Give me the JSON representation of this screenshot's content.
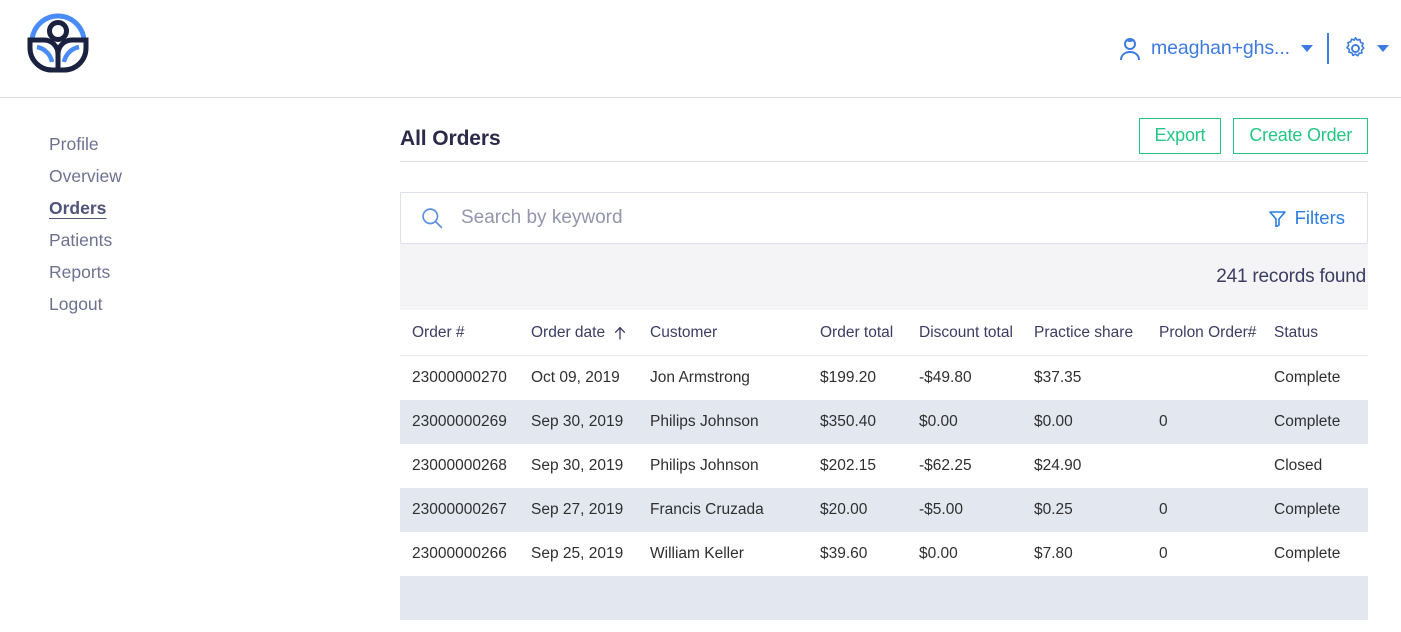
{
  "header": {
    "logo_name": "company-logo",
    "user": {
      "name": "meaghan+ghs...",
      "icon": "user-icon"
    },
    "settings": {
      "icon": "gear-icon"
    }
  },
  "sidebar": {
    "items": [
      {
        "label": "Profile",
        "active": false
      },
      {
        "label": "Overview",
        "active": false
      },
      {
        "label": "Orders",
        "active": true
      },
      {
        "label": "Patients",
        "active": false
      },
      {
        "label": "Reports",
        "active": false
      },
      {
        "label": "Logout",
        "active": false
      }
    ]
  },
  "main": {
    "title": "All Orders",
    "actions": {
      "export_label": "Export",
      "create_order_label": "Create Order"
    },
    "search": {
      "placeholder": "Search by keyword",
      "value": "",
      "icon": "search-icon"
    },
    "filters": {
      "label": "Filters",
      "icon": "filter-icon"
    },
    "records_found": "241 records found",
    "table": {
      "columns": [
        {
          "label": "Order #",
          "sort": null
        },
        {
          "label": "Order date",
          "sort": "asc"
        },
        {
          "label": "Customer",
          "sort": null
        },
        {
          "label": "Order total",
          "sort": null
        },
        {
          "label": "Discount total",
          "sort": null
        },
        {
          "label": "Practice share",
          "sort": null
        },
        {
          "label": "Prolon Order#",
          "sort": null
        },
        {
          "label": "Status",
          "sort": null
        }
      ],
      "rows": [
        {
          "order_number": "23000000270",
          "order_date": "Oct 09, 2019",
          "customer": "Jon Armstrong",
          "order_total": "$199.20",
          "discount_total": "-$49.80",
          "practice_share": "$37.35",
          "prolon_order": "",
          "status": "Complete"
        },
        {
          "order_number": "23000000269",
          "order_date": "Sep 30, 2019",
          "customer": "Philips Johnson",
          "order_total": "$350.40",
          "discount_total": "$0.00",
          "practice_share": "$0.00",
          "prolon_order": "0",
          "status": "Complete"
        },
        {
          "order_number": "23000000268",
          "order_date": "Sep 30, 2019",
          "customer": "Philips Johnson",
          "order_total": "$202.15",
          "discount_total": "-$62.25",
          "practice_share": "$24.90",
          "prolon_order": "",
          "status": "Closed"
        },
        {
          "order_number": "23000000267",
          "order_date": "Sep 27, 2019",
          "customer": "Francis Cruzada",
          "order_total": "$20.00",
          "discount_total": "-$5.00",
          "practice_share": "$0.25",
          "prolon_order": "0",
          "status": "Complete"
        },
        {
          "order_number": "23000000266",
          "order_date": "Sep 25, 2019",
          "customer": "William Keller",
          "order_total": "$39.60",
          "discount_total": "$0.00",
          "practice_share": "$7.80",
          "prolon_order": "0",
          "status": "Complete"
        },
        {
          "order_number": "",
          "order_date": "",
          "customer": "",
          "order_total": "",
          "discount_total": "",
          "practice_share": "",
          "prolon_order": "",
          "status": ""
        }
      ]
    }
  },
  "colors": {
    "brand_blue": "#3d7be0",
    "accent_green": "#25c685",
    "link_blue": "#2a7de1",
    "text_dark": "#2b2b49",
    "row_alt": "#e3e7f0",
    "band_gray": "#f4f4f6"
  }
}
